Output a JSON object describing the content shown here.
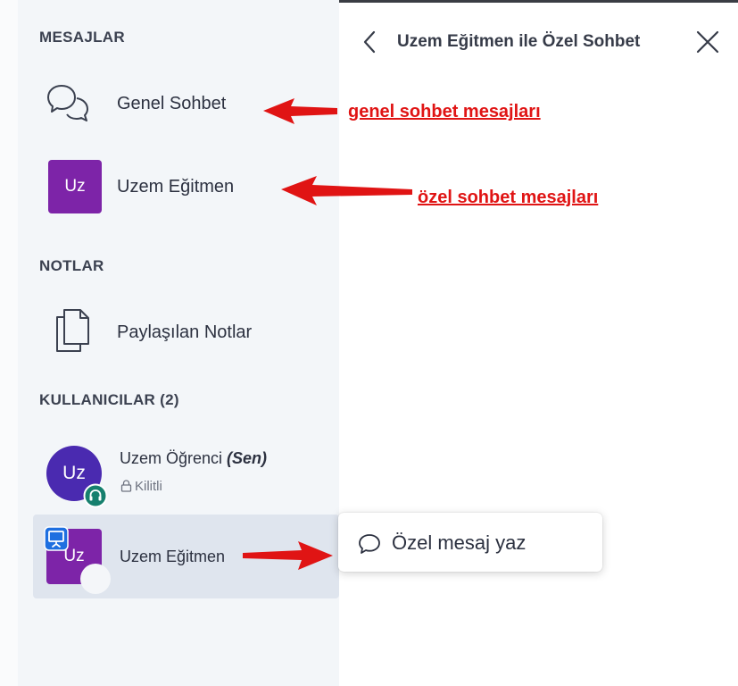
{
  "sidebar": {
    "messages_title": "MESAJLAR",
    "public_chat_label": "Genel Sohbet",
    "private_chat": {
      "avatar": "Uz",
      "label": "Uzem Eğitmen"
    },
    "notes_title": "NOTLAR",
    "shared_notes_label": "Paylaşılan Notlar",
    "users_title": "KULLANICILAR (2)",
    "users": [
      {
        "avatar": "Uz",
        "name": "Uzem Öğrenci",
        "suffix": "(Sen)",
        "status": "Kilitli"
      },
      {
        "avatar": "Uz",
        "name": "Uzem Eğitmen"
      }
    ]
  },
  "chat_header": {
    "title": "Uzem Eğitmen ile Özel Sohbet"
  },
  "popover": {
    "label": "Özel mesaj yaz"
  },
  "annotations": {
    "public": "genel sohbet mesajları",
    "private": "özel sohbet mesajları"
  },
  "colors": {
    "sidebar_bg": "#f3f6f9",
    "avatar_purple": "#7d24a8",
    "avatar_indigo": "#4a2ab0",
    "annotation_red": "#e01414",
    "listen_badge": "#16806e",
    "presenter_badge": "#1e6fe0"
  },
  "icons": [
    "chat-bubbles-icon",
    "document-icon",
    "headphones-icon",
    "lock-icon",
    "presenter-icon",
    "chevron-left-icon",
    "close-icon",
    "chat-bubble-icon"
  ]
}
